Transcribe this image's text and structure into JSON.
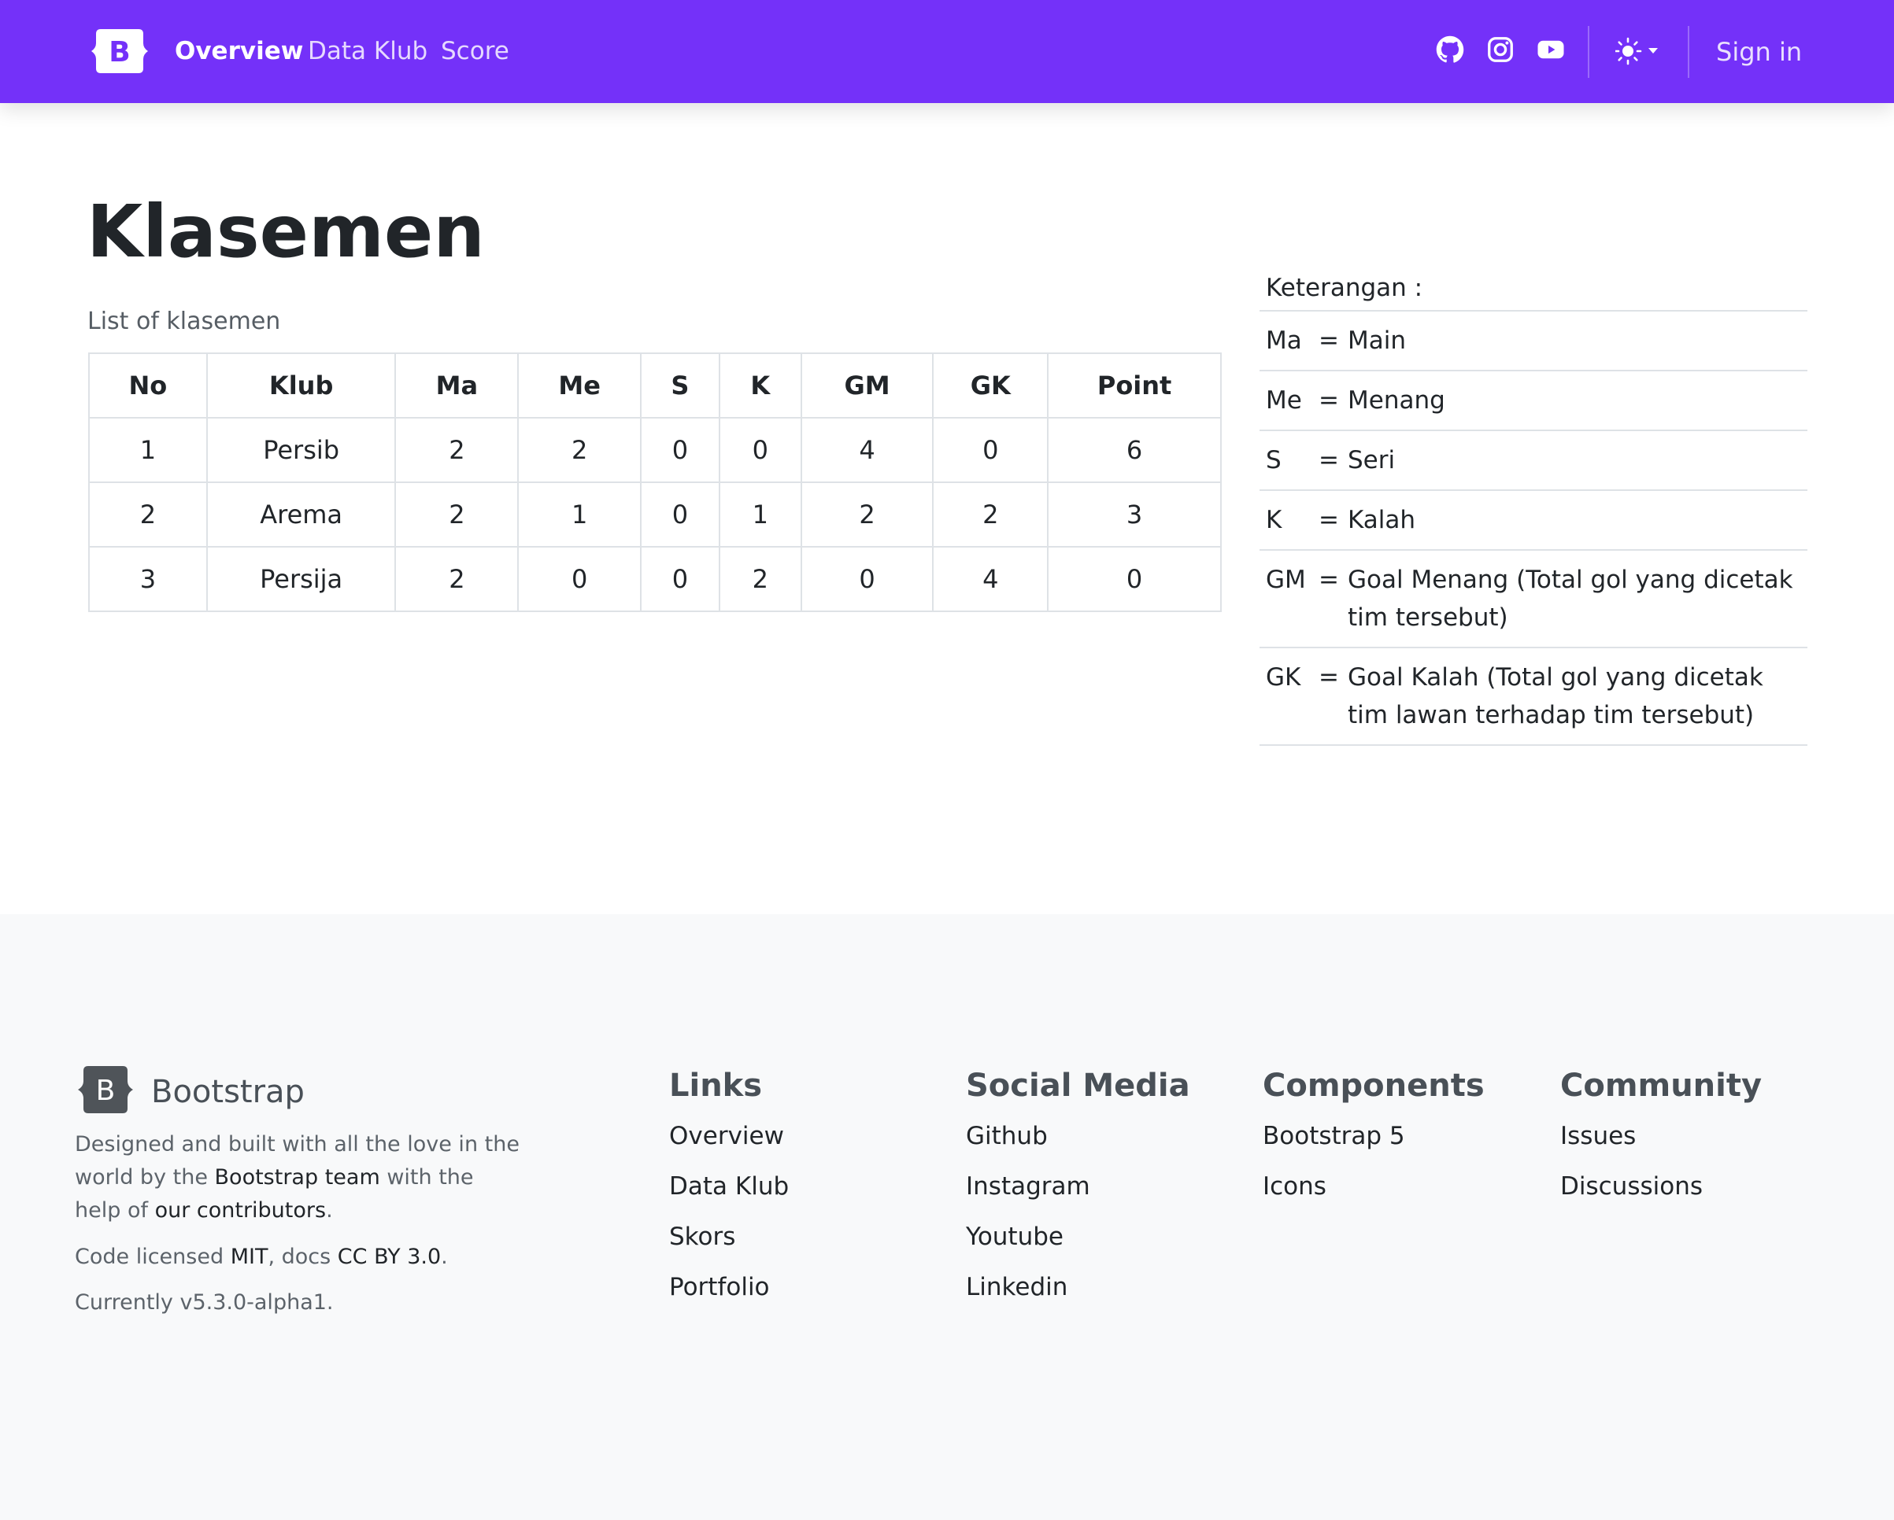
{
  "navbar": {
    "brand_letter": "B",
    "links": [
      {
        "label": "Overview",
        "active": true
      },
      {
        "label": "Data Klub",
        "active": false
      },
      {
        "label": "Score",
        "active": false
      }
    ],
    "social_icons": [
      "github-icon",
      "instagram-icon",
      "youtube-icon"
    ],
    "theme_icon": "sun-icon",
    "signin_label": "Sign in",
    "color": "#7431f9"
  },
  "main": {
    "title": "Klasemen",
    "caption": "List of klasemen",
    "table": {
      "headers": [
        "No",
        "Klub",
        "Ma",
        "Me",
        "S",
        "K",
        "GM",
        "GK",
        "Point"
      ],
      "rows": [
        [
          "1",
          "Persib",
          "2",
          "2",
          "0",
          "0",
          "4",
          "0",
          "6"
        ],
        [
          "2",
          "Arema",
          "2",
          "1",
          "0",
          "1",
          "2",
          "2",
          "3"
        ],
        [
          "3",
          "Persija",
          "2",
          "0",
          "0",
          "2",
          "0",
          "4",
          "0"
        ]
      ]
    },
    "legend": {
      "heading": "Keterangan :",
      "items": [
        {
          "abbr": "Ma",
          "eq": "=",
          "desc": "Main"
        },
        {
          "abbr": "Me",
          "eq": "=",
          "desc": "Menang"
        },
        {
          "abbr": "S",
          "eq": "=",
          "desc": "Seri"
        },
        {
          "abbr": "K",
          "eq": "=",
          "desc": "Kalah"
        },
        {
          "abbr": "GM",
          "eq": "=",
          "desc": "Goal Menang (Total gol yang dicetak tim tersebut)"
        },
        {
          "abbr": "GK",
          "eq": "=",
          "desc": "Goal Kalah (Total gol yang dicetak tim lawan terhadap tim tersebut)"
        }
      ]
    }
  },
  "footer": {
    "brand": "Bootstrap",
    "line1": "Designed and built with all the love in the",
    "line2_pre": "world by the ",
    "line2_link": "Bootstrap team",
    "line2_post": " with the",
    "line3_pre": "help of ",
    "line3_link": "our contributors",
    "line3_post": ".",
    "license_pre": "Code licensed ",
    "license_mit": "MIT",
    "license_mid": ", docs ",
    "license_cc": "CC BY 3.0",
    "license_post": ".",
    "version": "Currently v5.3.0-alpha1.",
    "columns": [
      {
        "title": "Links",
        "items": [
          "Overview",
          "Data Klub",
          "Skors",
          "Portfolio"
        ]
      },
      {
        "title": "Social Media",
        "items": [
          "Github",
          "Instagram",
          "Youtube",
          "Linkedin"
        ]
      },
      {
        "title": "Components",
        "items": [
          "Bootstrap 5",
          "Icons"
        ]
      },
      {
        "title": "Community",
        "items": [
          "Issues",
          "Discussions"
        ]
      }
    ]
  }
}
